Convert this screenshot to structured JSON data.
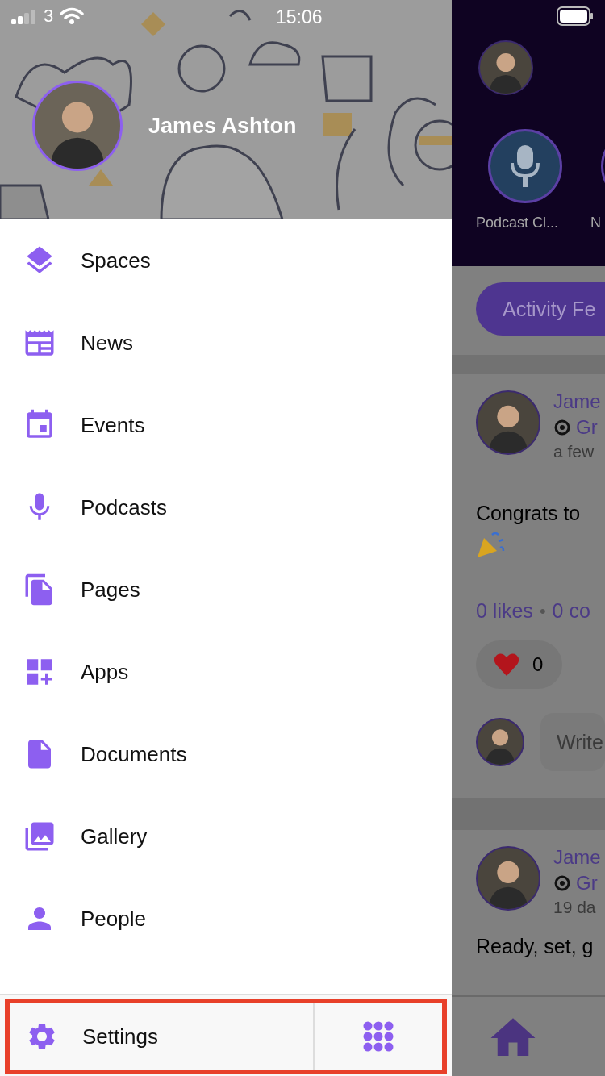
{
  "status_bar": {
    "carrier": "3",
    "time": "15:06"
  },
  "drawer": {
    "profile": {
      "name": "James Ashton"
    },
    "menu": [
      {
        "label": "Spaces"
      },
      {
        "label": "News"
      },
      {
        "label": "Events"
      },
      {
        "label": "Podcasts"
      },
      {
        "label": "Pages"
      },
      {
        "label": "Apps"
      },
      {
        "label": "Documents"
      },
      {
        "label": "Gallery"
      },
      {
        "label": "People"
      }
    ],
    "footer": {
      "label": "Settings",
      "highlighted": true
    }
  },
  "background": {
    "stories": [
      {
        "label": "Podcast Cl..."
      },
      {
        "label": "N"
      }
    ],
    "tab": {
      "label": "Activity Fe",
      "selected": true
    },
    "posts": [
      {
        "author": "Jame",
        "group": "Gr",
        "time": "a few",
        "text": "Congrats to",
        "likes": "0 likes",
        "separator": "•",
        "comments": "0 co",
        "reaction_count": "0",
        "comment_placeholder": "Write"
      },
      {
        "author": "Jame",
        "group": "Gr",
        "time": "19 da",
        "text": "Ready, set, g"
      }
    ]
  }
}
